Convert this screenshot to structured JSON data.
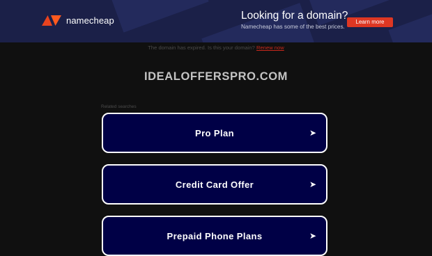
{
  "banner": {
    "brand": "namecheap",
    "title": "Looking for a domain?",
    "subtitle": "Namecheap has some of the best prices.",
    "cta": "Learn more"
  },
  "notice": {
    "text": "The domain has expired. Is this your domain?",
    "link": "Renew now"
  },
  "domain": "IDEALOFFERSPRO.COM",
  "related": {
    "heading": "Related searches",
    "items": [
      {
        "label": "Pro Plan"
      },
      {
        "label": "Credit Card Offer"
      },
      {
        "label": "Prepaid Phone Plans"
      }
    ],
    "arrow_icon": "arrow-right-icon"
  },
  "colors": {
    "background": "#101010",
    "banner": "#1b2048",
    "brand_accent": "#de3723",
    "button_bg": "#000046",
    "button_border": "#ffffff"
  }
}
